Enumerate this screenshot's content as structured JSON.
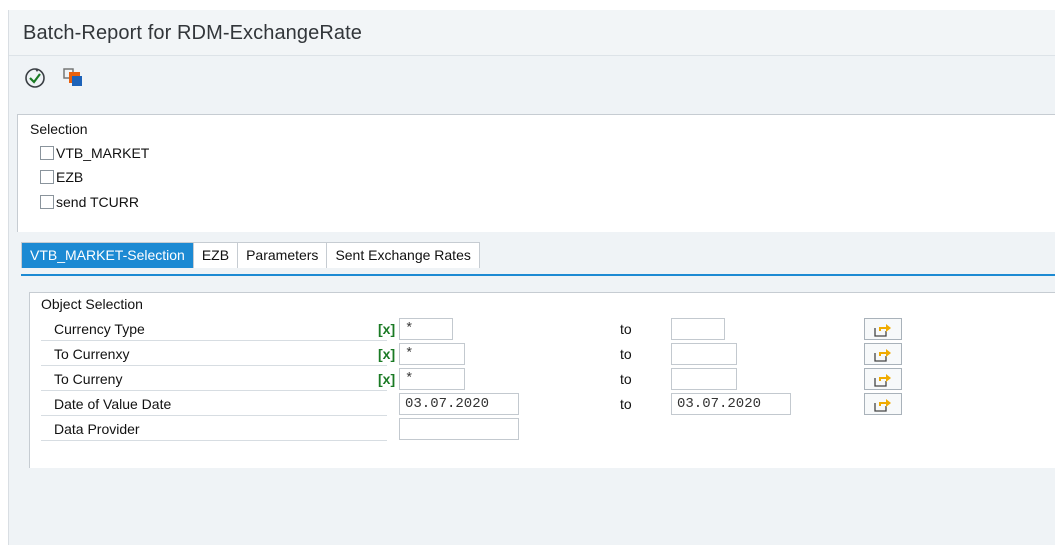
{
  "header": {
    "title": "Batch-Report for RDM-ExchangeRate"
  },
  "toolbar": [
    {
      "name": "execute-icon",
      "tooltip": ""
    },
    {
      "name": "variant-icon",
      "tooltip": ""
    }
  ],
  "selection": {
    "title": "Selection",
    "options": [
      {
        "label": "VTB_MARKET",
        "checked": false
      },
      {
        "label": "EZB",
        "checked": false
      },
      {
        "label": "send TCURR",
        "checked": false
      }
    ]
  },
  "tabs": [
    {
      "label": "VTB_MARKET-Selection",
      "active": true
    },
    {
      "label": "EZB",
      "active": false
    },
    {
      "label": "Parameters",
      "active": false
    },
    {
      "label": "Sent Exchange Rates",
      "active": false
    }
  ],
  "object_selection": {
    "title": "Object Selection",
    "to_label": "to",
    "rows": [
      {
        "label": "Currency Type",
        "flag": "[x]",
        "from": "*",
        "to": ""
      },
      {
        "label": "To Currenxy",
        "flag": "[x]",
        "from": "*",
        "to": ""
      },
      {
        "label": "To Curreny",
        "flag": "[x]",
        "from": "*",
        "to": ""
      },
      {
        "label": "Date of Value Date",
        "flag": "",
        "from": "03.07.2020",
        "to": "03.07.2020"
      },
      {
        "label": "Data Provider",
        "flag": "",
        "from": "",
        "to": ""
      }
    ]
  },
  "colors": {
    "accent": "#1c8ad3",
    "flag_green": "#1a7a24",
    "arrow_orange": "#f0ab00"
  }
}
